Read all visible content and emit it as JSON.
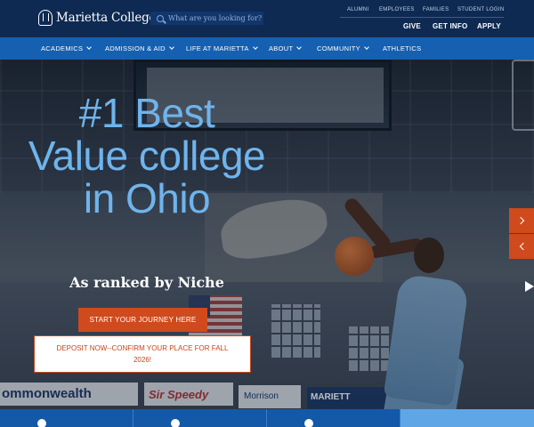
{
  "header": {
    "logo_text": "Marietta College",
    "search_placeholder": "What are you looking for?",
    "utility_links": [
      "ALUMNI",
      "EMPLOYEES",
      "FAMILIES",
      "STUDENT LOGIN"
    ],
    "action_links": [
      "GIVE",
      "GET INFO",
      "APPLY"
    ]
  },
  "nav": {
    "items": [
      {
        "label": "ACADEMICS",
        "dropdown": true
      },
      {
        "label": "ADMISSION & AID",
        "dropdown": true
      },
      {
        "label": "LIFE AT MARIETTA",
        "dropdown": true
      },
      {
        "label": "ABOUT",
        "dropdown": true
      },
      {
        "label": "COMMUNITY",
        "dropdown": true
      },
      {
        "label": "ATHLETICS",
        "dropdown": false
      }
    ]
  },
  "hero": {
    "headline": "#1 Best Value college in Ohio",
    "subline": "As ranked by Niche",
    "primary_button": "START YOUR JOURNEY HERE",
    "secondary_button": "DEPOSIT NOW--CONFIRM YOUR PLACE FOR FALL 2026!",
    "banners": [
      "ommonwealth",
      "Sir Speedy",
      "Morrison",
      "MARIETT"
    ],
    "next_icon": "chevron-right-icon",
    "prev_icon": "chevron-left-icon"
  },
  "colors": {
    "header_bg": "#0e2a52",
    "nav_bg": "#1560b0",
    "accent_orange": "#cf4a1c",
    "headline_blue": "#6fb4ec"
  }
}
